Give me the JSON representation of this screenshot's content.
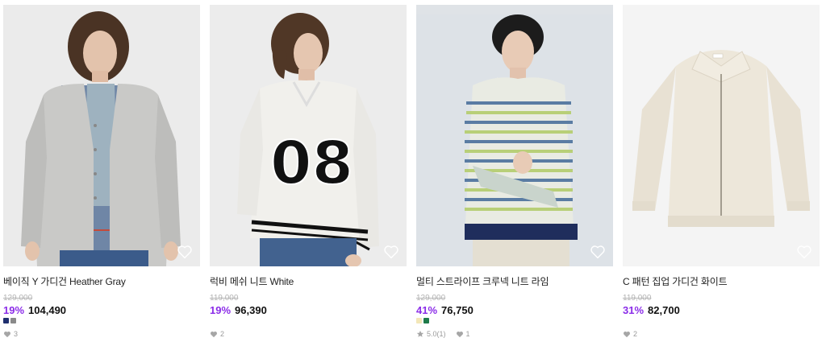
{
  "products": [
    {
      "name": "베이직 Y 가디건 Heather Gray",
      "original_price": "129,000",
      "discount": "19%",
      "price": "104,490",
      "swatches": [
        "#1f2f6e",
        "#8a8a8a"
      ],
      "likes": "3"
    },
    {
      "name": "럭비 메쉬 니트 White",
      "original_price": "119,000",
      "discount": "19%",
      "price": "96,390",
      "likes": "2"
    },
    {
      "name": "멀티 스트라이프 크루넥 니트 라임",
      "original_price": "129,000",
      "discount": "41%",
      "price": "76,750",
      "swatches": [
        "#f3e7b8",
        "#1e7a4a"
      ],
      "rating": "5.0(1)",
      "likes": "1"
    },
    {
      "name": "C 패턴 집업 가디건 화이트",
      "original_price": "119,000",
      "discount": "31%",
      "price": "82,700",
      "likes": "2"
    }
  ],
  "icons": {
    "wishlist": "heart-outline-icon",
    "likes": "heart-filled-icon",
    "rating": "star-icon"
  }
}
